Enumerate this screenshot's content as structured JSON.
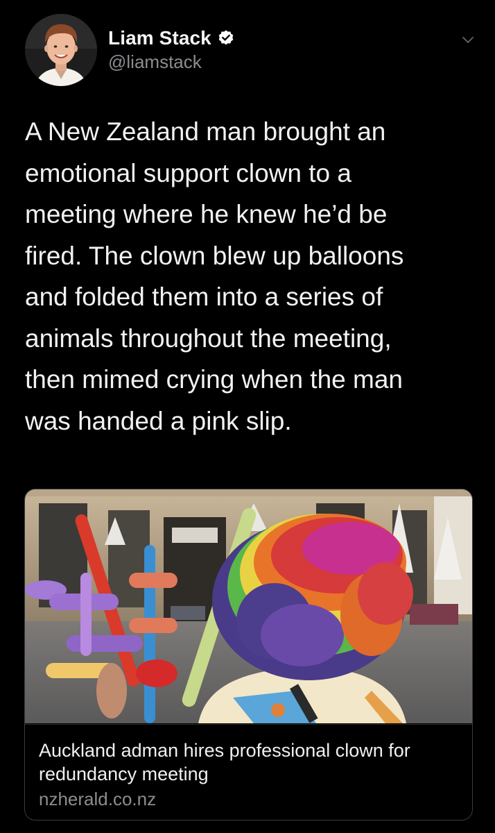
{
  "tweet": {
    "author": {
      "name": "Liam Stack",
      "handle": "@liamstack",
      "verified": true,
      "avatar_icon": "profile-photo"
    },
    "menu_icon": "chevron-down-icon",
    "text": "A New Zealand man brought an\nemotional support clown to a\nmeeting where he knew he’d be\nfired. The clown blew up balloons\nand folded them into a series of\nanimals throughout the meeting,\nthen mimed crying when the man\nwas handed a pink slip."
  },
  "link_card": {
    "image_icon": "clown-rainbow-wig-photo",
    "title": "Auckland adman hires professional clown for redundancy meeting",
    "domain": "nzherald.co.nz"
  },
  "colors": {
    "background": "#000000",
    "text_primary": "#f2f2f2",
    "text_secondary": "#8a8d91",
    "verified_badge": "#ffffff",
    "card_border": "#3a3b3e"
  }
}
